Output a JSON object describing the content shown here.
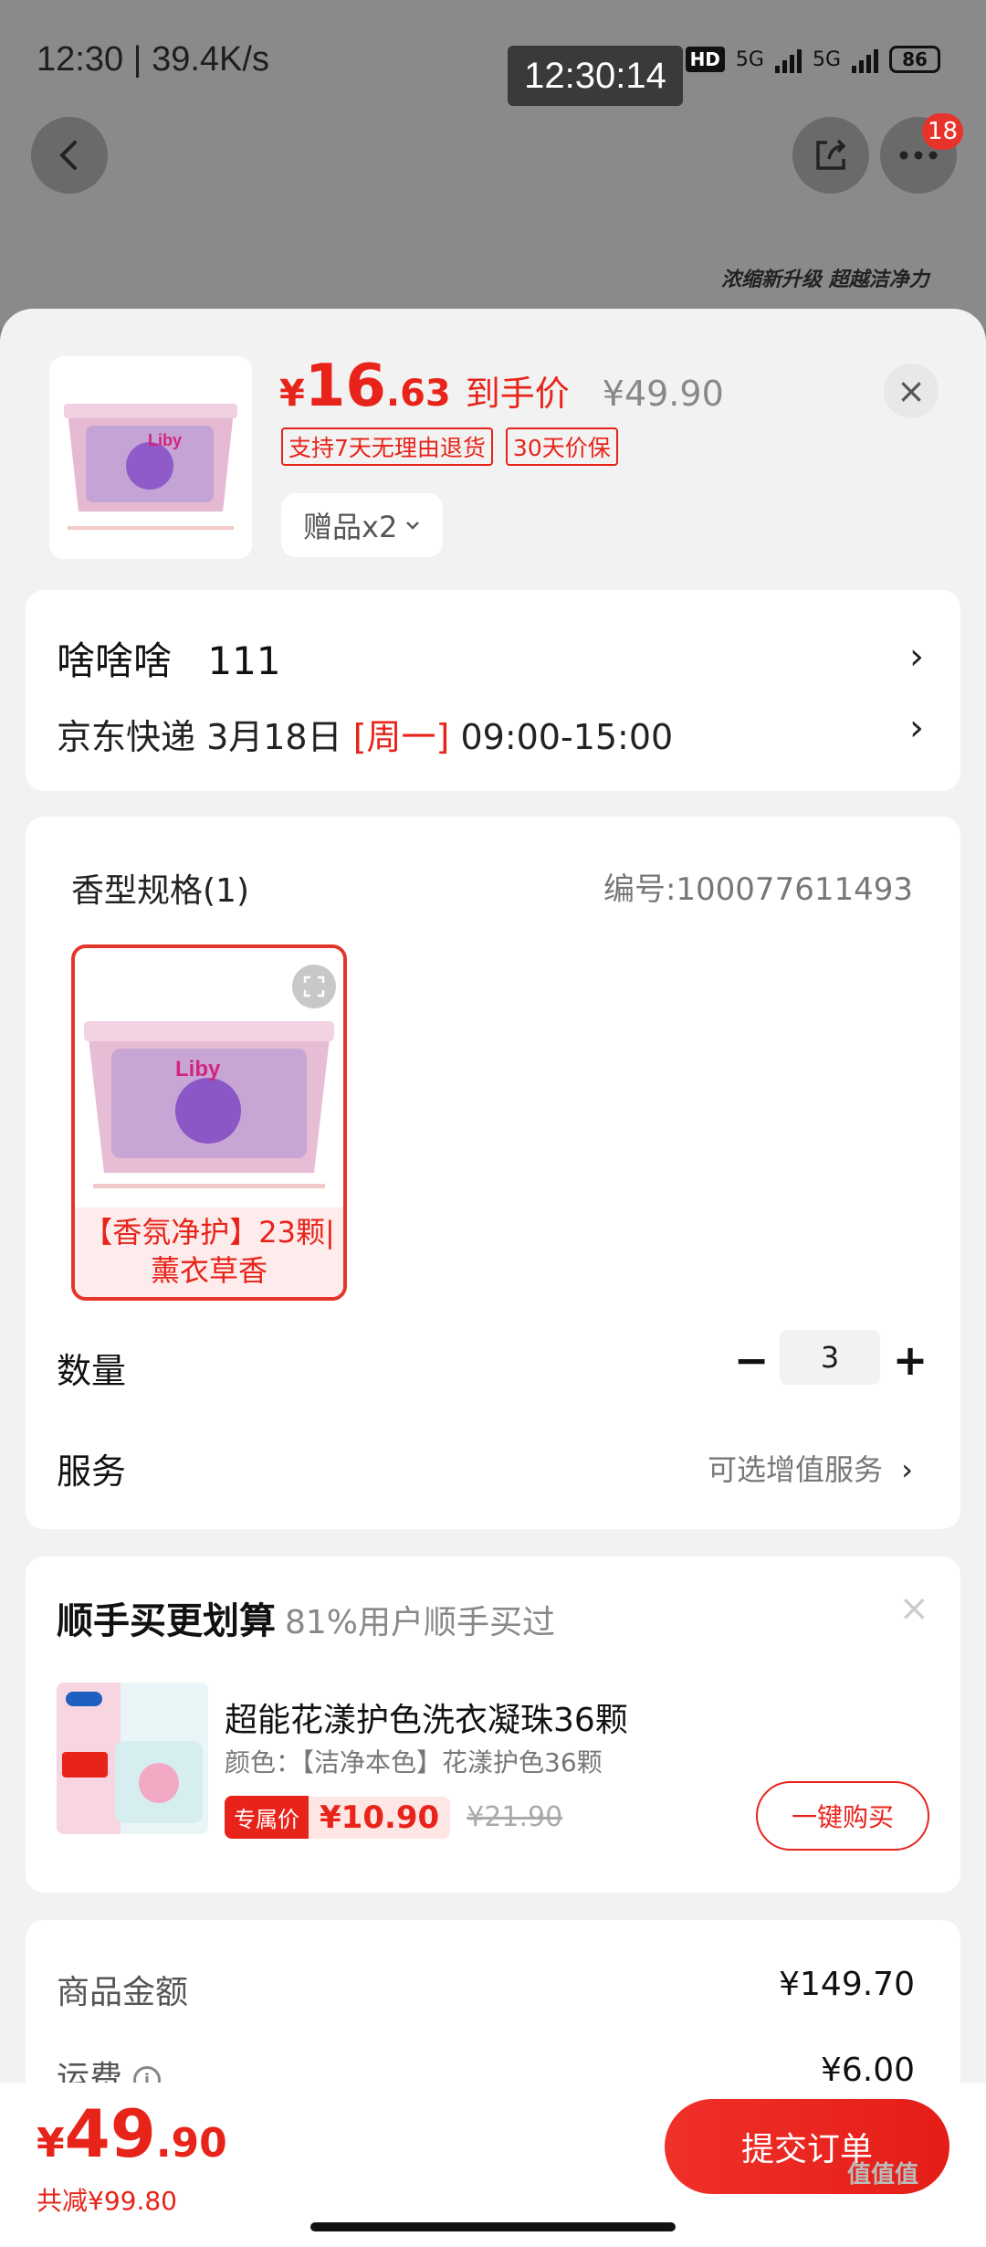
{
  "status_bar": {
    "left": "12:30 | 39.4K/s",
    "clock": "12:30:14",
    "hd": "HD",
    "net1": "5G",
    "net2": "5G",
    "battery": "86"
  },
  "top_actions": {
    "badge_count": "18"
  },
  "background_banner": "浓缩新升级 超越洁净力",
  "product": {
    "brand": "Liby",
    "price_yen": "¥",
    "price_int": "16",
    "price_dec": ".63",
    "price_tag": "到手价",
    "original_price": "¥49.90",
    "badges": [
      "支持7天无理由退货",
      "30天价保"
    ],
    "gift_label": "赠品x2"
  },
  "address": {
    "name": "啥啥啥",
    "phone": "111",
    "carrier_date": "京东快递 3月18日",
    "weekday": "[周一]",
    "time": "09:00-15:00"
  },
  "spec": {
    "title": "香型规格(1)",
    "code": "编号:100077611493",
    "option_label": "【香氛净护】23颗|薰衣草香",
    "quantity_label": "数量",
    "quantity": "3",
    "service_label": "服务",
    "service_value": "可选增值服务"
  },
  "addon": {
    "title": "顺手买更划算",
    "subtitle": "81%用户顺手买过",
    "name": "超能花漾护色洗衣凝珠36颗",
    "spec": "颜色：【洁净本色】花漾护色36颗",
    "exclusive": "专属价",
    "price": "¥10.90",
    "original": "¥21.90",
    "buy_label": "一键购买"
  },
  "summary": {
    "goods_label": "商品金额",
    "goods_value": "¥149.70",
    "shipping_label": "运费",
    "shipping_value": "¥6.00"
  },
  "checkout": {
    "yen": "¥",
    "total_int": "49",
    "total_dec": ".90",
    "saving": "共减¥99.80",
    "submit_label": "提交订单"
  },
  "watermark": "值值值",
  "colors": {
    "accent": "#e8231a",
    "sheet_bg": "#f2f2f2",
    "card_bg": "#ffffff"
  }
}
